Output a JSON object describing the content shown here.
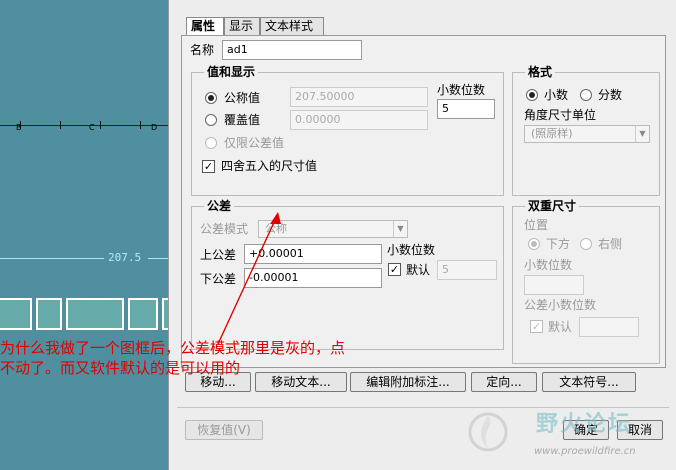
{
  "cad": {
    "ruler_labels": [
      "B",
      "C",
      "D"
    ],
    "dimension_text": "207.5"
  },
  "dialog": {
    "tabs": [
      {
        "label": "属性",
        "active": true
      },
      {
        "label": "显示",
        "active": false
      },
      {
        "label": "文本样式",
        "active": false
      }
    ],
    "name_label": "名称",
    "name_value": "ad1",
    "value_display": {
      "title": "值和显示",
      "nominal_label": "公称值",
      "nominal_value": "207.50000",
      "override_label": "覆盖值",
      "override_value": "0.00000",
      "tolerance_only_label": "仅限公差值",
      "decimal_places_label": "小数位数",
      "decimal_places_value": "5",
      "round_label": "四舍五入的尺寸值"
    },
    "format": {
      "title": "格式",
      "decimal_label": "小数",
      "fraction_label": "分数",
      "angle_unit_label": "角度尺寸单位",
      "angle_unit_value": "(照原样)"
    },
    "tolerance": {
      "title": "公差",
      "mode_label": "公差模式",
      "mode_value": "公称",
      "upper_label": "上公差",
      "upper_value": "+0.00001",
      "lower_label": "下公差",
      "lower_value": "-0.00001",
      "decimal_places_label": "小数位数",
      "default_label": "默认",
      "decimal_places_value": "5"
    },
    "dual": {
      "title": "双重尺寸",
      "position_label": "位置",
      "below_label": "下方",
      "right_label": "右侧",
      "decimal_places_label": "小数位数",
      "tol_decimal_places_label": "公差小数位数",
      "default_label": "默认"
    },
    "buttons": {
      "move": "移动...",
      "move_text": "移动文本...",
      "edit_attach": "编辑附加标注...",
      "orient": "定向...",
      "text_symbol": "文本符号...",
      "restore": "恢复值(V)",
      "ok": "确定",
      "cancel": "取消"
    }
  },
  "annotation": {
    "line1": "为什么我做了一个图框后，公差模式那里是灰的，点",
    "line2": "不动了。而又软件默认的是可以用的",
    "color": "#e00000"
  },
  "watermark": {
    "title": "野火论坛",
    "url": "www.proewildfire.cn"
  }
}
